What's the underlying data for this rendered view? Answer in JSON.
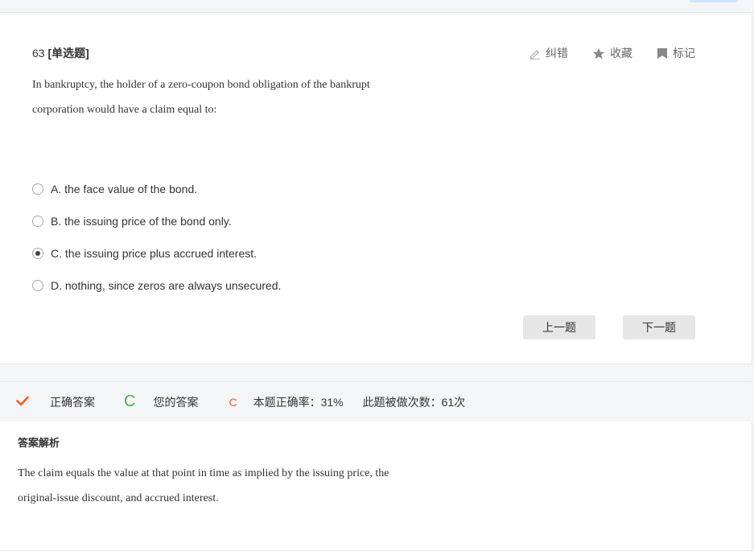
{
  "question": {
    "number": "63",
    "type": "[单选题]",
    "text": "In bankruptcy, the holder of a zero-coupon bond obligation of the bankrupt corporation would have a claim equal to:",
    "options": [
      {
        "label": "A. the face value of the bond.",
        "selected": false
      },
      {
        "label": "B. the issuing price of the bond only.",
        "selected": false
      },
      {
        "label": "C. the issuing price plus accrued interest.",
        "selected": true
      },
      {
        "label": "D. nothing, since zeros are always unsecured.",
        "selected": false
      }
    ]
  },
  "tools": {
    "report_label": "纠错",
    "favorite_label": "收藏",
    "mark_label": "标记"
  },
  "navigation": {
    "prev_label": "上一题",
    "next_label": "下一题"
  },
  "answer_bar": {
    "correct_label": "正确答案",
    "correct_value": "C",
    "your_label": "您的答案",
    "your_value": "C",
    "accuracy_text": "本题正确率：31%",
    "attempts_text": "此题被做次数：61次"
  },
  "analysis": {
    "title": "答案解析",
    "text": "The claim equals the value at that point in time as implied by the issuing price, the original-issue discount, and accrued interest."
  },
  "colors": {
    "check": "#ff5722",
    "correct": "#4caf50",
    "yours": "#ff5722",
    "button_bg": "#e6e6e6"
  }
}
